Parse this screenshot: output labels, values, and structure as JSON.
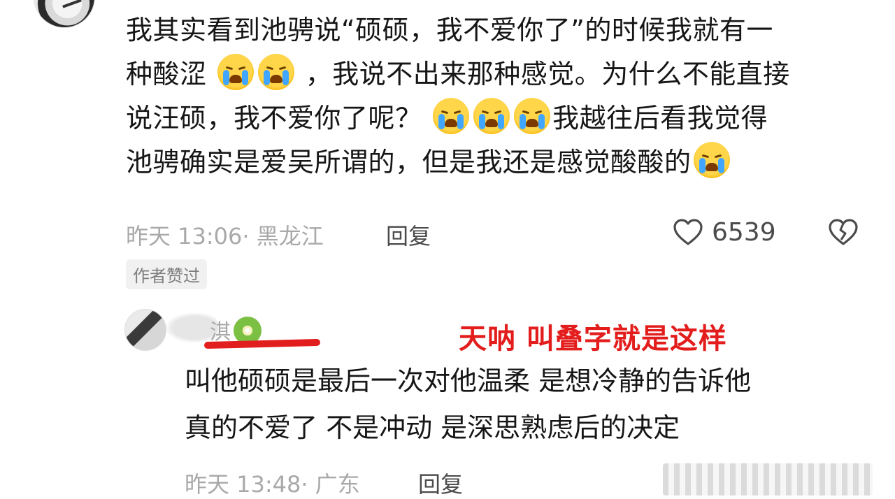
{
  "comment1": {
    "lines": [
      "我其实看到池骋说“硕硕，我不爱你了”的时候我就有一",
      "种酸涩",
      "，我说不出来那种感觉。为什么不能直接",
      "说汪硕，我不爱你了呢？",
      "我越往后看我觉得",
      "池骋确实是爱吴所谓的，但是我还是感觉酸酸的"
    ],
    "time_location": "昨天 13:06· 黑龙江",
    "reply_label": "回复",
    "like_count": "6539",
    "author_liked_badge": "作者赞过"
  },
  "comment2": {
    "username": "淇",
    "annotation": "天呐 叫叠字就是这样",
    "lines": [
      "叫他硕硕是最后一次对他温柔 是想冷静的告诉他",
      "真的不爱了 不是冲动 是深思熟虑后的决定"
    ],
    "time_location": "昨天 13:48· 广东",
    "reply_label": "回复"
  },
  "icons": {
    "emoji": "loudly-crying-face",
    "like": "heart-outline-icon",
    "dislike": "broken-heart-icon",
    "username_emoji": "kiwi-icon"
  },
  "colors": {
    "annotation": "#e31c1c",
    "meta": "#a9a9a9"
  }
}
